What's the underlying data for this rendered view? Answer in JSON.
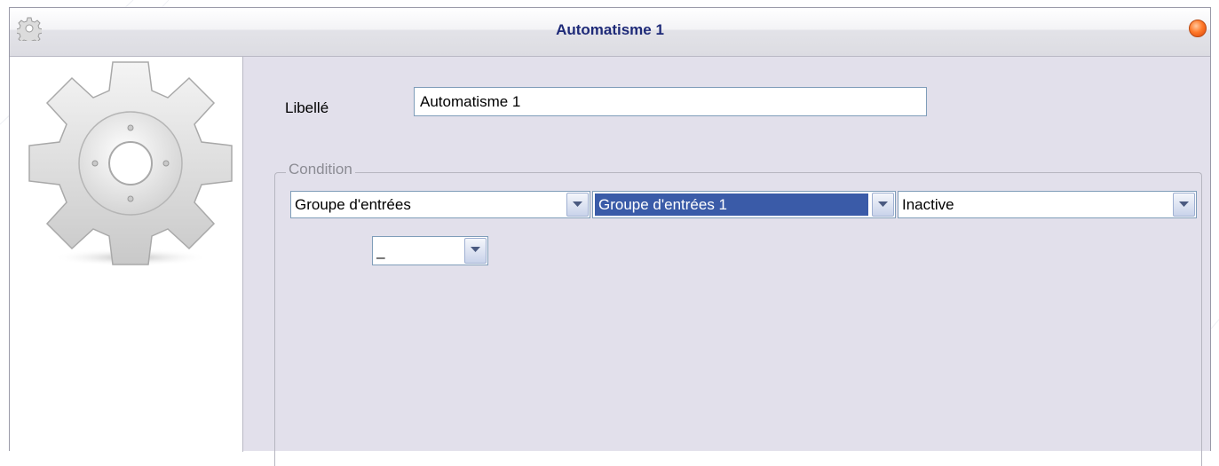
{
  "window": {
    "title": "Automatisme 1"
  },
  "form": {
    "libelle_label": "Libellé",
    "libelle_value": "Automatisme 1"
  },
  "condition": {
    "legend": "Condition",
    "combo_type": "Groupe d'entrées",
    "combo_group": "Groupe d'entrées 1",
    "combo_state": "Inactive",
    "combo_operator": "_"
  },
  "colors": {
    "title_text": "#1e2a78",
    "selection": "#3a5ba8",
    "window_bg": "#e2e0eb"
  },
  "icons": {
    "title": "gear-icon",
    "panel": "gear-icon",
    "close": "close-icon",
    "dropdown": "chevron-down-icon"
  }
}
